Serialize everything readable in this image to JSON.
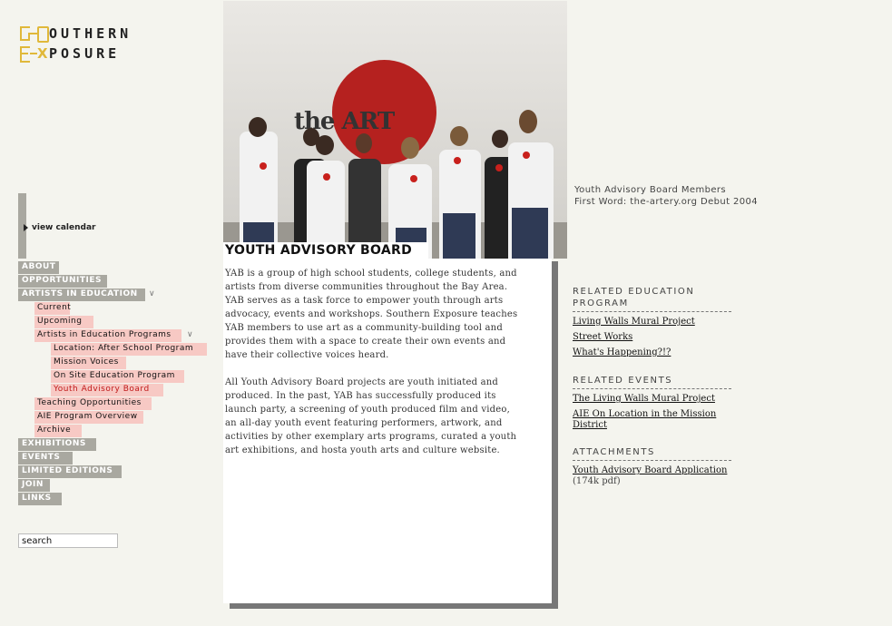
{
  "logo": {
    "line1": "OUTHERN",
    "line2": "POSURE"
  },
  "view_calendar": "view calendar",
  "nav": {
    "about": "ABOUT",
    "opportunities": "OPPORTUNITIES",
    "artists_in_education": "ARTISTS IN EDUCATION",
    "current": "Current",
    "upcoming": "Upcoming",
    "artists_programs": "Artists in Education Programs",
    "location": "Location: After School Program",
    "mission_voices": "Mission Voices",
    "on_site": "On Site Education Program",
    "youth_advisory": "Youth Advisory Board",
    "teaching": "Teaching Opportunities",
    "aie_overview": "AIE Program Overview",
    "archive": "Archive",
    "exhibitions": "EXHIBITIONS",
    "events": "EVENTS",
    "limited": "LIMITED EDITIONS",
    "join": "JOIN",
    "links": "LINKS",
    "chevron": "∨"
  },
  "search": {
    "value": "search"
  },
  "photo": {
    "wall_text": "the ART"
  },
  "caption": {
    "line1": "Youth Advisory Board Members",
    "line2": "First Word: the-artery.org Debut 2004"
  },
  "main": {
    "title": "YOUTH ADVISORY BOARD",
    "para1": "YAB is a group of high school students, college students, and artists from diverse communities throughout the Bay Area. YAB serves as a task force to empower youth through arts advocacy, events and workshops. Southern Exposure teaches YAB members to use art as a community-building tool and provides them with a space to create their own events and have their collective voices heard.",
    "para2": "All Youth Advisory Board projects are youth initiated and produced. In the past, YAB has successfully produced its launch party, a screening of youth produced film and video, an all-day youth event featuring performers, artwork, and activities by other exemplary arts programs, curated a youth art exhibitions, and hosta youth arts and culture website."
  },
  "sidebar": {
    "related_education": {
      "heading": "RELATED EDUCATION PROGRAM",
      "links": [
        "Living Walls Mural Project",
        "Street Works",
        "What's Happening?!?"
      ]
    },
    "related_events": {
      "heading": "RELATED EVENTS",
      "links": [
        "The Living Walls Mural Project",
        "AIE On Location in the Mission District"
      ]
    },
    "attachments": {
      "heading": "ATTACHMENTS",
      "link": "Youth Advisory Board Application",
      "meta": " (174k pdf)"
    }
  }
}
